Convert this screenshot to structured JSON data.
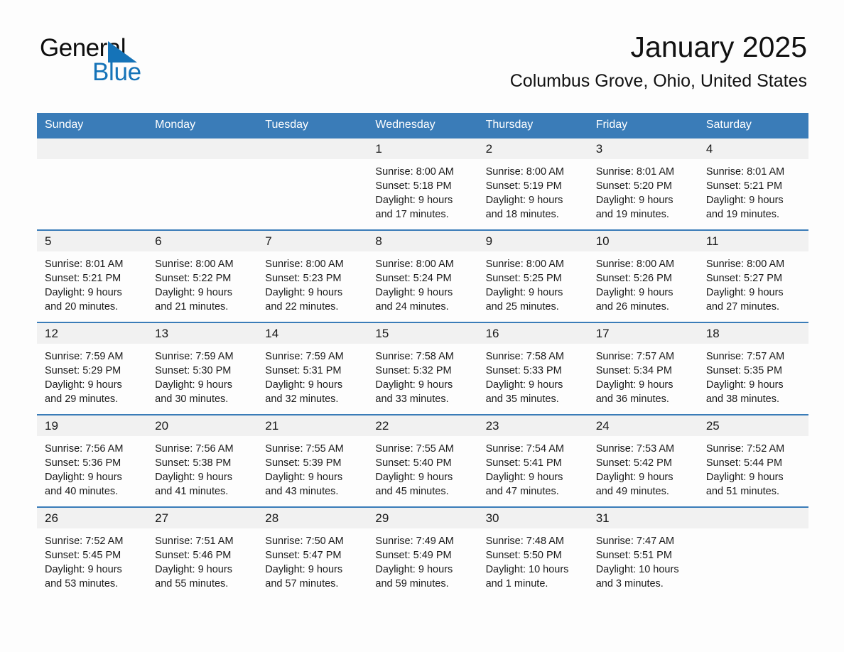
{
  "brand": {
    "name_part1": "General",
    "name_part2": "Blue",
    "accent_color": "#1573b8"
  },
  "header": {
    "title": "January 2025",
    "subtitle": "Columbus Grove, Ohio, United States"
  },
  "calendar": {
    "header_bg": "#3a7cb8",
    "daynum_bg": "#f1f1f1",
    "weekday_headers": [
      "Sunday",
      "Monday",
      "Tuesday",
      "Wednesday",
      "Thursday",
      "Friday",
      "Saturday"
    ],
    "weeks": [
      [
        {
          "day": "",
          "lines": []
        },
        {
          "day": "",
          "lines": []
        },
        {
          "day": "",
          "lines": []
        },
        {
          "day": "1",
          "lines": [
            "Sunrise: 8:00 AM",
            "Sunset: 5:18 PM",
            "Daylight: 9 hours",
            "and 17 minutes."
          ]
        },
        {
          "day": "2",
          "lines": [
            "Sunrise: 8:00 AM",
            "Sunset: 5:19 PM",
            "Daylight: 9 hours",
            "and 18 minutes."
          ]
        },
        {
          "day": "3",
          "lines": [
            "Sunrise: 8:01 AM",
            "Sunset: 5:20 PM",
            "Daylight: 9 hours",
            "and 19 minutes."
          ]
        },
        {
          "day": "4",
          "lines": [
            "Sunrise: 8:01 AM",
            "Sunset: 5:21 PM",
            "Daylight: 9 hours",
            "and 19 minutes."
          ]
        }
      ],
      [
        {
          "day": "5",
          "lines": [
            "Sunrise: 8:01 AM",
            "Sunset: 5:21 PM",
            "Daylight: 9 hours",
            "and 20 minutes."
          ]
        },
        {
          "day": "6",
          "lines": [
            "Sunrise: 8:00 AM",
            "Sunset: 5:22 PM",
            "Daylight: 9 hours",
            "and 21 minutes."
          ]
        },
        {
          "day": "7",
          "lines": [
            "Sunrise: 8:00 AM",
            "Sunset: 5:23 PM",
            "Daylight: 9 hours",
            "and 22 minutes."
          ]
        },
        {
          "day": "8",
          "lines": [
            "Sunrise: 8:00 AM",
            "Sunset: 5:24 PM",
            "Daylight: 9 hours",
            "and 24 minutes."
          ]
        },
        {
          "day": "9",
          "lines": [
            "Sunrise: 8:00 AM",
            "Sunset: 5:25 PM",
            "Daylight: 9 hours",
            "and 25 minutes."
          ]
        },
        {
          "day": "10",
          "lines": [
            "Sunrise: 8:00 AM",
            "Sunset: 5:26 PM",
            "Daylight: 9 hours",
            "and 26 minutes."
          ]
        },
        {
          "day": "11",
          "lines": [
            "Sunrise: 8:00 AM",
            "Sunset: 5:27 PM",
            "Daylight: 9 hours",
            "and 27 minutes."
          ]
        }
      ],
      [
        {
          "day": "12",
          "lines": [
            "Sunrise: 7:59 AM",
            "Sunset: 5:29 PM",
            "Daylight: 9 hours",
            "and 29 minutes."
          ]
        },
        {
          "day": "13",
          "lines": [
            "Sunrise: 7:59 AM",
            "Sunset: 5:30 PM",
            "Daylight: 9 hours",
            "and 30 minutes."
          ]
        },
        {
          "day": "14",
          "lines": [
            "Sunrise: 7:59 AM",
            "Sunset: 5:31 PM",
            "Daylight: 9 hours",
            "and 32 minutes."
          ]
        },
        {
          "day": "15",
          "lines": [
            "Sunrise: 7:58 AM",
            "Sunset: 5:32 PM",
            "Daylight: 9 hours",
            "and 33 minutes."
          ]
        },
        {
          "day": "16",
          "lines": [
            "Sunrise: 7:58 AM",
            "Sunset: 5:33 PM",
            "Daylight: 9 hours",
            "and 35 minutes."
          ]
        },
        {
          "day": "17",
          "lines": [
            "Sunrise: 7:57 AM",
            "Sunset: 5:34 PM",
            "Daylight: 9 hours",
            "and 36 minutes."
          ]
        },
        {
          "day": "18",
          "lines": [
            "Sunrise: 7:57 AM",
            "Sunset: 5:35 PM",
            "Daylight: 9 hours",
            "and 38 minutes."
          ]
        }
      ],
      [
        {
          "day": "19",
          "lines": [
            "Sunrise: 7:56 AM",
            "Sunset: 5:36 PM",
            "Daylight: 9 hours",
            "and 40 minutes."
          ]
        },
        {
          "day": "20",
          "lines": [
            "Sunrise: 7:56 AM",
            "Sunset: 5:38 PM",
            "Daylight: 9 hours",
            "and 41 minutes."
          ]
        },
        {
          "day": "21",
          "lines": [
            "Sunrise: 7:55 AM",
            "Sunset: 5:39 PM",
            "Daylight: 9 hours",
            "and 43 minutes."
          ]
        },
        {
          "day": "22",
          "lines": [
            "Sunrise: 7:55 AM",
            "Sunset: 5:40 PM",
            "Daylight: 9 hours",
            "and 45 minutes."
          ]
        },
        {
          "day": "23",
          "lines": [
            "Sunrise: 7:54 AM",
            "Sunset: 5:41 PM",
            "Daylight: 9 hours",
            "and 47 minutes."
          ]
        },
        {
          "day": "24",
          "lines": [
            "Sunrise: 7:53 AM",
            "Sunset: 5:42 PM",
            "Daylight: 9 hours",
            "and 49 minutes."
          ]
        },
        {
          "day": "25",
          "lines": [
            "Sunrise: 7:52 AM",
            "Sunset: 5:44 PM",
            "Daylight: 9 hours",
            "and 51 minutes."
          ]
        }
      ],
      [
        {
          "day": "26",
          "lines": [
            "Sunrise: 7:52 AM",
            "Sunset: 5:45 PM",
            "Daylight: 9 hours",
            "and 53 minutes."
          ]
        },
        {
          "day": "27",
          "lines": [
            "Sunrise: 7:51 AM",
            "Sunset: 5:46 PM",
            "Daylight: 9 hours",
            "and 55 minutes."
          ]
        },
        {
          "day": "28",
          "lines": [
            "Sunrise: 7:50 AM",
            "Sunset: 5:47 PM",
            "Daylight: 9 hours",
            "and 57 minutes."
          ]
        },
        {
          "day": "29",
          "lines": [
            "Sunrise: 7:49 AM",
            "Sunset: 5:49 PM",
            "Daylight: 9 hours",
            "and 59 minutes."
          ]
        },
        {
          "day": "30",
          "lines": [
            "Sunrise: 7:48 AM",
            "Sunset: 5:50 PM",
            "Daylight: 10 hours",
            "and 1 minute."
          ]
        },
        {
          "day": "31",
          "lines": [
            "Sunrise: 7:47 AM",
            "Sunset: 5:51 PM",
            "Daylight: 10 hours",
            "and 3 minutes."
          ]
        },
        {
          "day": "",
          "lines": []
        }
      ]
    ]
  }
}
